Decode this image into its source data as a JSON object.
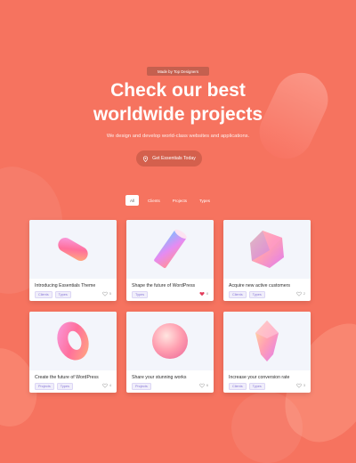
{
  "hero": {
    "badge": "Made by Top Designers",
    "title_line1": "Check our best",
    "title_line2": "worldwide projects",
    "subtitle": "We design and develop world-class websites and applications.",
    "cta_label": "Get Essentials Today",
    "cta_icon": "location-pin-icon"
  },
  "filters": [
    {
      "label": "All",
      "active": true
    },
    {
      "label": "Clients",
      "active": false
    },
    {
      "label": "Projects",
      "active": false
    },
    {
      "label": "Types",
      "active": false
    }
  ],
  "projects": [
    {
      "title": "Introducing Essentials Theme",
      "tags": [
        "Clients",
        "Types"
      ],
      "likes": "5",
      "liked": false,
      "shape": "capsule"
    },
    {
      "title": "Shape the future of WordPress",
      "tags": [
        "Types"
      ],
      "likes": "8",
      "liked": true,
      "shape": "cylinder"
    },
    {
      "title": "Acquire new active customers",
      "tags": [
        "Clients",
        "Types"
      ],
      "likes": "2",
      "liked": false,
      "shape": "polyhedron"
    },
    {
      "title": "Create the future of WordPress",
      "tags": [
        "Projects",
        "Types"
      ],
      "likes": "4",
      "liked": false,
      "shape": "torus"
    },
    {
      "title": "Share your stunning works",
      "tags": [
        "Projects"
      ],
      "likes": "6",
      "liked": false,
      "shape": "sphere"
    },
    {
      "title": "Increase your conversion rate",
      "tags": [
        "Clients",
        "Types"
      ],
      "likes": "3",
      "liked": false,
      "shape": "gem"
    }
  ],
  "colors": {
    "background": "#f6735f",
    "liked_heart": "#e23b5a"
  }
}
